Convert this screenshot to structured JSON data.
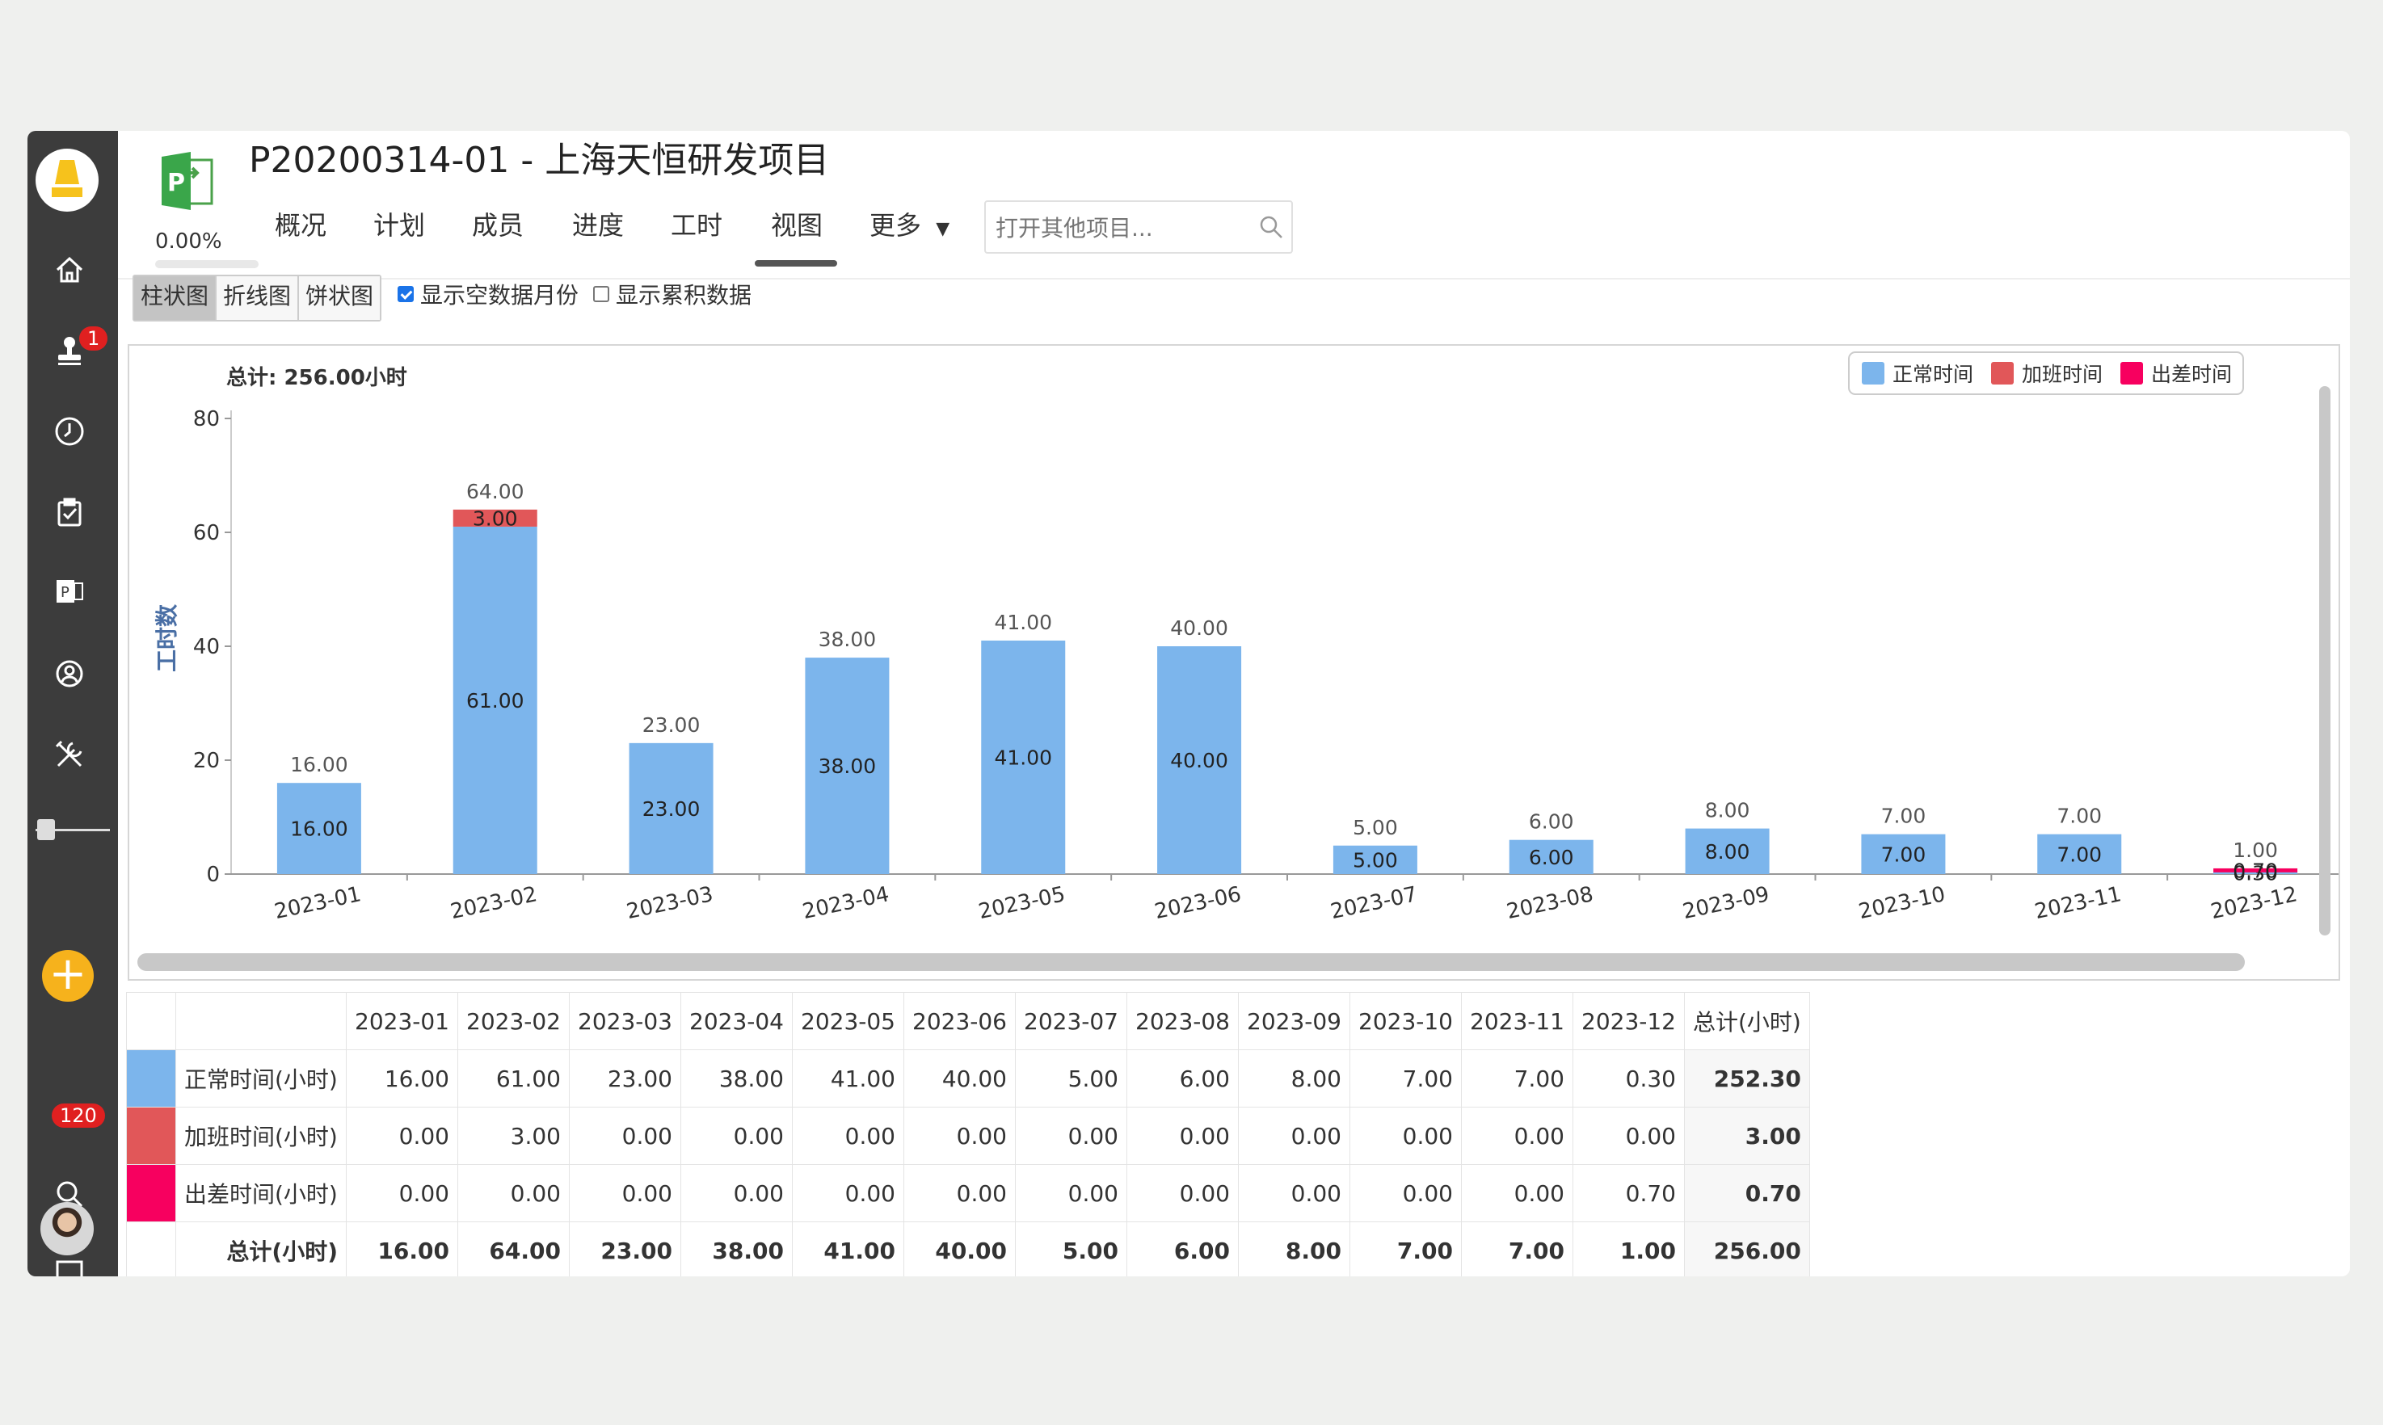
{
  "header": {
    "title": "P20200314-01 - 上海天恒研发项目",
    "progress": "0.00%",
    "tabs": [
      "概况",
      "计划",
      "成员",
      "进度",
      "工时",
      "视图",
      "更多"
    ],
    "active_tab": "视图",
    "search_placeholder": "打开其他项目..."
  },
  "sidebar": {
    "items": [
      "home-icon",
      "stamp-icon",
      "clock-icon",
      "clipboard-check-icon",
      "project-icon",
      "team-icon",
      "tools-icon"
    ],
    "stamp_badge": "1",
    "messages_badge": "120"
  },
  "view_options": {
    "buttons": [
      "柱状图",
      "折线图",
      "饼状图"
    ],
    "active_button": "柱状图",
    "show_empty_months_label": "显示空数据月份",
    "show_empty_months_checked": true,
    "show_cumulative_label": "显示累积数据",
    "show_cumulative_checked": false
  },
  "chart_data": {
    "type": "bar",
    "stacked": true,
    "total_label": "总计: 256.00小时",
    "ylabel": "工时数",
    "ylim": [
      0,
      80
    ],
    "yticks": [
      0,
      20,
      40,
      60,
      80
    ],
    "legend_position": "top-right",
    "categories": [
      "2023-01",
      "2023-02",
      "2023-03",
      "2023-04",
      "2023-05",
      "2023-06",
      "2023-07",
      "2023-08",
      "2023-09",
      "2023-10",
      "2023-11",
      "2023-12"
    ],
    "series": [
      {
        "name": "正常时间",
        "color": "#7cb5ec",
        "values": [
          16,
          61,
          23,
          38,
          41,
          40,
          5,
          6,
          8,
          7,
          7,
          0.3
        ]
      },
      {
        "name": "加班时间",
        "color": "#e15759",
        "values": [
          0,
          3,
          0,
          0,
          0,
          0,
          0,
          0,
          0,
          0,
          0,
          0
        ]
      },
      {
        "name": "出差时间",
        "color": "#f7005f",
        "values": [
          0,
          0,
          0,
          0,
          0,
          0,
          0,
          0,
          0,
          0,
          0,
          0.7
        ]
      }
    ],
    "totals": [
      16,
      64,
      23,
      38,
      41,
      40,
      5,
      6,
      8,
      7,
      7,
      1
    ]
  },
  "table": {
    "headers": [
      "2023-01",
      "2023-02",
      "2023-03",
      "2023-04",
      "2023-05",
      "2023-06",
      "2023-07",
      "2023-08",
      "2023-09",
      "2023-10",
      "2023-11",
      "2023-12",
      "总计(小时)"
    ],
    "rows": [
      {
        "label": "正常时间(小时)",
        "color": "#7cb5ec",
        "values": [
          "16.00",
          "61.00",
          "23.00",
          "38.00",
          "41.00",
          "40.00",
          "5.00",
          "6.00",
          "8.00",
          "7.00",
          "7.00",
          "0.30"
        ],
        "total": "252.30"
      },
      {
        "label": "加班时间(小时)",
        "color": "#e15759",
        "values": [
          "0.00",
          "3.00",
          "0.00",
          "0.00",
          "0.00",
          "0.00",
          "0.00",
          "0.00",
          "0.00",
          "0.00",
          "0.00",
          "0.00"
        ],
        "total": "3.00"
      },
      {
        "label": "出差时间(小时)",
        "color": "#f7005f",
        "values": [
          "0.00",
          "0.00",
          "0.00",
          "0.00",
          "0.00",
          "0.00",
          "0.00",
          "0.00",
          "0.00",
          "0.00",
          "0.00",
          "0.70"
        ],
        "total": "0.70"
      }
    ],
    "total_row": {
      "label": "总计(小时)",
      "values": [
        "16.00",
        "64.00",
        "23.00",
        "38.00",
        "41.00",
        "40.00",
        "5.00",
        "6.00",
        "8.00",
        "7.00",
        "7.00",
        "1.00"
      ],
      "total": "256.00"
    }
  }
}
